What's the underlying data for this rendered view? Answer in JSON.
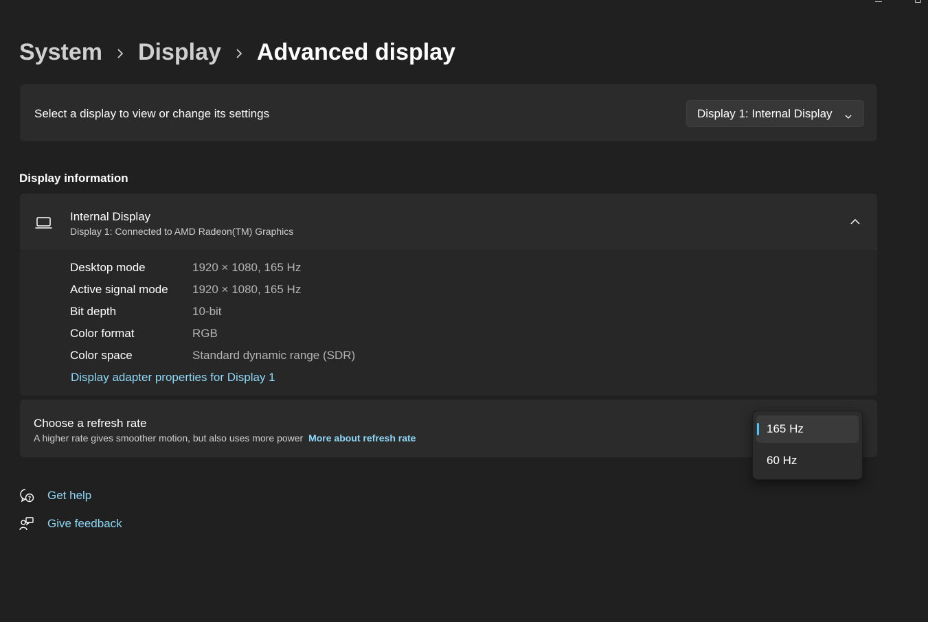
{
  "breadcrumb": {
    "items": [
      "System",
      "Display",
      "Advanced display"
    ]
  },
  "select_display": {
    "label": "Select a display to view or change its settings",
    "selected": "Display 1: Internal Display"
  },
  "display_information": {
    "heading": "Display information",
    "title": "Internal Display",
    "subtitle": "Display 1: Connected to AMD Radeon(TM) Graphics",
    "properties": [
      {
        "label": "Desktop mode",
        "value": "1920 × 1080, 165 Hz"
      },
      {
        "label": "Active signal mode",
        "value": "1920 × 1080, 165 Hz"
      },
      {
        "label": "Bit depth",
        "value": "10-bit"
      },
      {
        "label": "Color format",
        "value": "RGB"
      },
      {
        "label": "Color space",
        "value": "Standard dynamic range (SDR)"
      }
    ],
    "adapter_link": "Display adapter properties for Display 1"
  },
  "refresh_rate": {
    "title": "Choose a refresh rate",
    "description": "A higher rate gives smoother motion, but also uses more power",
    "more_link": "More about refresh rate",
    "options": [
      "165 Hz",
      "60 Hz"
    ],
    "selected_index": 0
  },
  "help": {
    "get_help": "Get help",
    "give_feedback": "Give feedback"
  },
  "colors": {
    "background": "#202020",
    "card": "#2b2b2b",
    "accent": "#4cc2ff",
    "link": "#8fd8f8"
  },
  "icons": {
    "laptop": "laptop-icon",
    "chevron_up": "chevron-up-icon",
    "chevron_down": "chevron-down-icon",
    "chevron_right": "chevron-right-icon",
    "help": "help-chat-icon",
    "feedback": "feedback-icon"
  }
}
